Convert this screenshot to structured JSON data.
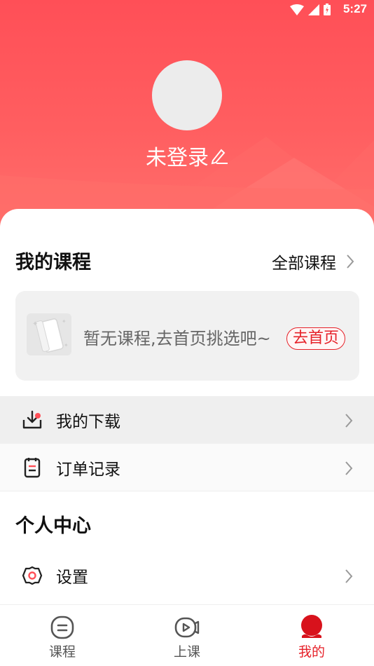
{
  "status_bar": {
    "time": "5:27"
  },
  "profile": {
    "username": "未登录"
  },
  "my_courses": {
    "title": "我的课程",
    "all_link": "全部课程",
    "empty_text": "暂无课程,去首页挑选吧~",
    "go_home_button": "去首页"
  },
  "menu": {
    "download": "我的下载",
    "orders": "订单记录"
  },
  "personal_center": {
    "title": "个人中心",
    "settings": "设置"
  },
  "tab_bar": {
    "tabs": [
      {
        "label": "课程",
        "icon": "course-icon"
      },
      {
        "label": "上课",
        "icon": "live-class-icon"
      },
      {
        "label": "我的",
        "icon": "profile-icon"
      }
    ],
    "active_index": 2
  },
  "colors": {
    "accent": "#e62129",
    "header_bg": "#ff5557",
    "row_bg": "#efefef"
  }
}
